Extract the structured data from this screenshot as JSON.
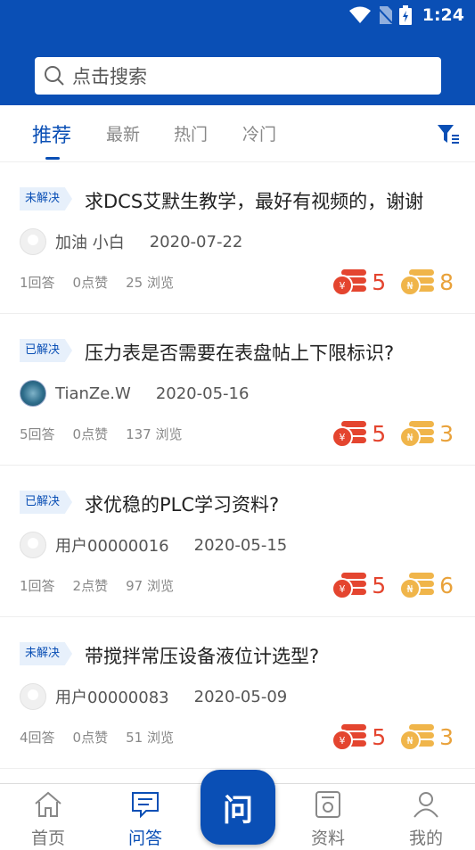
{
  "status_bar": {
    "time": "1:24"
  },
  "search": {
    "placeholder": "点击搜索"
  },
  "tabs": [
    {
      "label": "推荐",
      "active": true
    },
    {
      "label": "最新",
      "active": false
    },
    {
      "label": "热门",
      "active": false
    },
    {
      "label": "冷门",
      "active": false
    }
  ],
  "questions": [
    {
      "status": "未解决",
      "title": "求DCS艾默生教学，最好有视频的，谢谢",
      "author": "加油 小白",
      "date": "2020-07-22",
      "answers": "1回答",
      "likes": "0点赞",
      "views": "25 浏览",
      "reward_red": "5",
      "reward_gold": "8",
      "avatar": "default"
    },
    {
      "status": "已解决",
      "title": "压力表是否需要在表盘帖上下限标识?",
      "author": "TianZe.W",
      "date": "2020-05-16",
      "answers": "5回答",
      "likes": "0点赞",
      "views": "137 浏览",
      "reward_red": "5",
      "reward_gold": "3",
      "avatar": "photo"
    },
    {
      "status": "已解决",
      "title": "求优稳的PLC学习资料?",
      "author": "用户00000016",
      "date": "2020-05-15",
      "answers": "1回答",
      "likes": "2点赞",
      "views": "97 浏览",
      "reward_red": "5",
      "reward_gold": "6",
      "avatar": "default"
    },
    {
      "status": "未解决",
      "title": "带搅拌常压设备液位计选型?",
      "author": "用户00000083",
      "date": "2020-05-09",
      "answers": "4回答",
      "likes": "0点赞",
      "views": "51 浏览",
      "reward_red": "5",
      "reward_gold": "3",
      "avatar": "default"
    }
  ],
  "bottom_nav": {
    "home": "首页",
    "qa": "问答",
    "ask": "问",
    "materials": "资料",
    "mine": "我的"
  },
  "colors": {
    "primary": "#0a4fb5",
    "red_coin": "#e4452f",
    "gold_coin": "#e9a23b"
  }
}
